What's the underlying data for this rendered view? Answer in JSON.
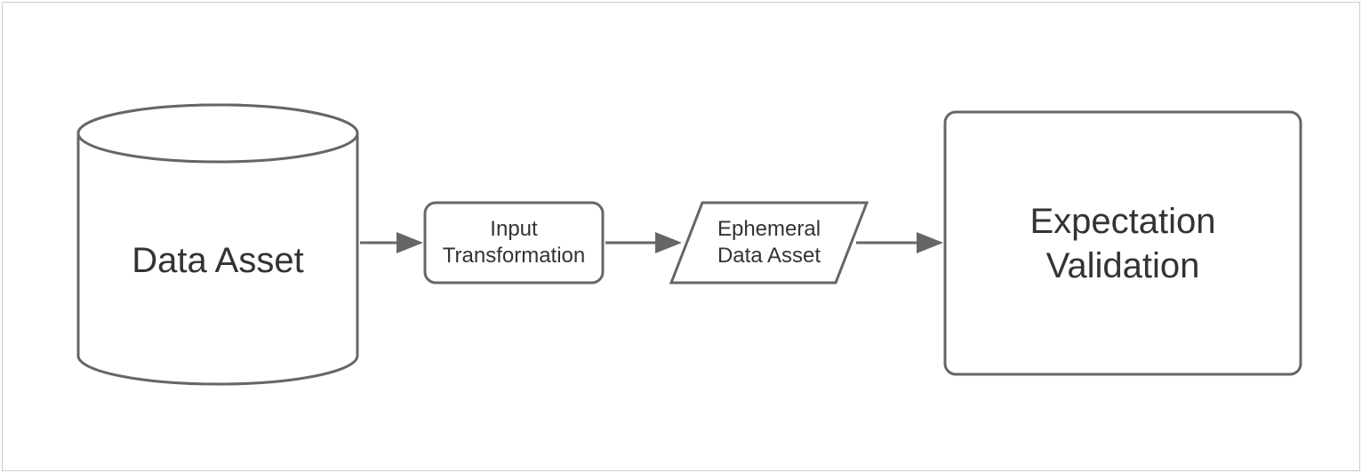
{
  "diagram": {
    "nodes": {
      "data_asset": {
        "label": "Data Asset",
        "shape": "cylinder"
      },
      "input_transformation": {
        "label_line1": "Input",
        "label_line2": "Transformation",
        "shape": "rounded-rect"
      },
      "ephemeral_data_asset": {
        "label_line1": "Ephemeral",
        "label_line2": "Data Asset",
        "shape": "parallelogram"
      },
      "expectation_validation": {
        "label_line1": "Expectation",
        "label_line2": "Validation",
        "shape": "rounded-rect"
      }
    },
    "edges": [
      {
        "from": "data_asset",
        "to": "input_transformation"
      },
      {
        "from": "input_transformation",
        "to": "ephemeral_data_asset"
      },
      {
        "from": "ephemeral_data_asset",
        "to": "expectation_validation"
      }
    ],
    "style": {
      "stroke": "#666666",
      "fill": "#ffffff",
      "text": "#333333"
    }
  }
}
